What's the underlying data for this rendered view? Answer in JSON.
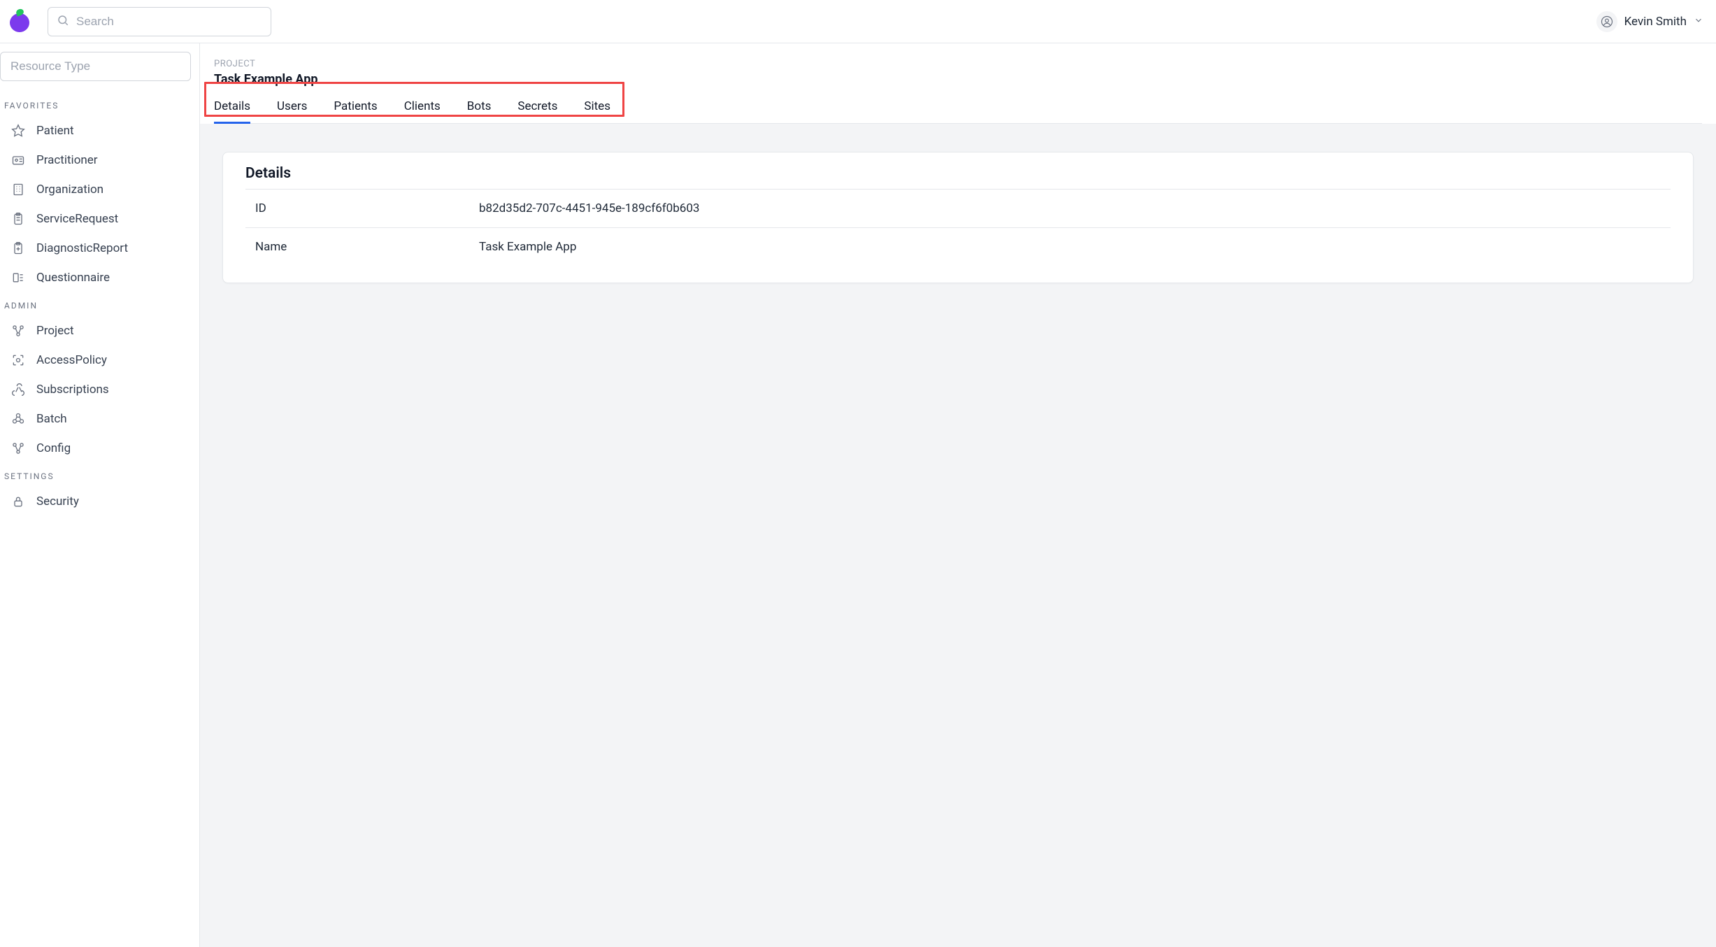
{
  "header": {
    "search_placeholder": "Search",
    "user_name": "Kevin Smith"
  },
  "sidebar": {
    "resource_type_placeholder": "Resource Type",
    "sections": [
      {
        "header": "FAVORITES",
        "items": [
          {
            "label": "Patient",
            "icon": "star-icon"
          },
          {
            "label": "Practitioner",
            "icon": "id-card-icon"
          },
          {
            "label": "Organization",
            "icon": "building-icon"
          },
          {
            "label": "ServiceRequest",
            "icon": "clipboard-icon"
          },
          {
            "label": "DiagnosticReport",
            "icon": "clipboard-plus-icon"
          },
          {
            "label": "Questionnaire",
            "icon": "form-icon"
          }
        ]
      },
      {
        "header": "ADMIN",
        "items": [
          {
            "label": "Project",
            "icon": "nodes-icon"
          },
          {
            "label": "AccessPolicy",
            "icon": "scan-icon"
          },
          {
            "label": "Subscriptions",
            "icon": "webhook-icon"
          },
          {
            "label": "Batch",
            "icon": "atoms-icon"
          },
          {
            "label": "Config",
            "icon": "nodes-icon"
          }
        ]
      },
      {
        "header": "SETTINGS",
        "items": [
          {
            "label": "Security",
            "icon": "lock-icon"
          }
        ]
      }
    ]
  },
  "main": {
    "eyebrow": "PROJECT",
    "title": "Task Example App",
    "tabs": [
      {
        "label": "Details",
        "active": true
      },
      {
        "label": "Users",
        "active": false
      },
      {
        "label": "Patients",
        "active": false
      },
      {
        "label": "Clients",
        "active": false
      },
      {
        "label": "Bots",
        "active": false
      },
      {
        "label": "Secrets",
        "active": false
      },
      {
        "label": "Sites",
        "active": false
      }
    ],
    "card": {
      "heading": "Details",
      "rows": [
        {
          "k": "ID",
          "v": "b82d35d2-707c-4451-945e-189cf6f0b603"
        },
        {
          "k": "Name",
          "v": "Task Example App"
        }
      ]
    }
  }
}
